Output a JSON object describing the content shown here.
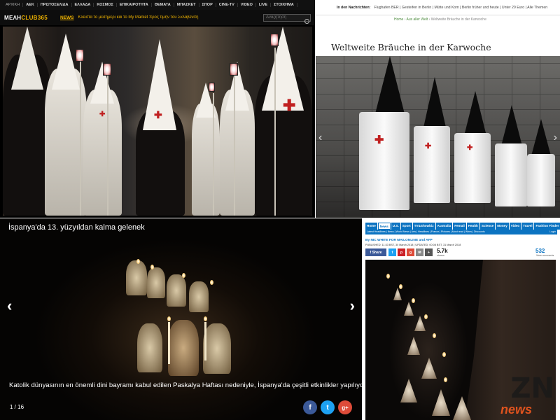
{
  "greek_site": {
    "nav": [
      "ΑΡΧΙΚΗ",
      "ΑΕΚ",
      "ΠΡΩΤΟΣΕΛΙΔΑ",
      "ΕΛΛΑΔΑ",
      "ΚΟΣΜΟΣ",
      "ΕΠΙΚΑΙΡΟΤΗΤΑ",
      "ΘΕΜΑΤΑ",
      "ΜΠΑΣΚΕΤ",
      "ΣΠΟΡ",
      "CINE-TV",
      "VIDEO",
      "LIVE",
      "ΣΤΟΙΧΗΜΑ"
    ],
    "logo_main": "ΜΕΛΗ",
    "logo_accent": "CLUB365",
    "news_label": "NEWS",
    "ticker": "Κλειστά το μεσημέρι και το My Market προς τιμήν του Σκλαβενίτη",
    "search_placeholder": "Αναζήτηση",
    "search_icon": "search-icon"
  },
  "german_site": {
    "news_label": "In den Nachrichten:",
    "news_items": "Flughafen BER | Gesteifen in Berlin | Mütte und Kom | Berlin früher und heute | Unter 20 Euro | Alle Themen",
    "breadcrumb_home": "Home",
    "breadcrumb_section": "Aus aller Welt",
    "breadcrumb_current": "Weltweite Bräuche in der Karwoche",
    "title": "Weltweite Bräuche in der Karwoche",
    "arrow_left": "‹",
    "arrow_right": "›"
  },
  "turkish_site": {
    "title": "İspanya'da 13. yüzyıldan kalma gelenek",
    "caption": "Katolik dünyasının en önemli dini bayramı kabul edilen Paskalya Haftası nedeniyle, İspanya'da çeşitli etkinlikler yapılıyor.",
    "counter": "1 / 16",
    "arrow_left": "‹",
    "arrow_right": "›",
    "share_icons": [
      "facebook-icon",
      "twitter-icon",
      "google-plus-icon"
    ],
    "share_labels": [
      "f",
      "t",
      "g+"
    ],
    "share_colors": [
      "#3b5998",
      "#1da1f2",
      "#dd4b39"
    ]
  },
  "mail_online": {
    "nav": [
      "Home",
      "News",
      "U.S.",
      "Sport",
      "TV&Showbiz",
      "Australia",
      "Femail",
      "Health",
      "Science",
      "Money",
      "Video",
      "Travel",
      "Fashion Finder"
    ],
    "active_nav": "News",
    "subnav": "Latest Headlines | News | World News | Arts | Headlines | France | Pictures | Most read | Wires | Discounts",
    "login": "Login",
    "byline": "By NIC WHITE FOR MAILONLINE and AFP",
    "published": "PUBLISHED: 11:33 BST, 30 March 2018 | UPDATED: 00:08 BST, 31 March 2018",
    "share_label": "Share",
    "shares_count": "5.7k",
    "shares_label": "shares",
    "comments_count": "532",
    "comments_label": "View comments"
  },
  "watermark": {
    "zn": "ZN",
    "news": "news"
  }
}
